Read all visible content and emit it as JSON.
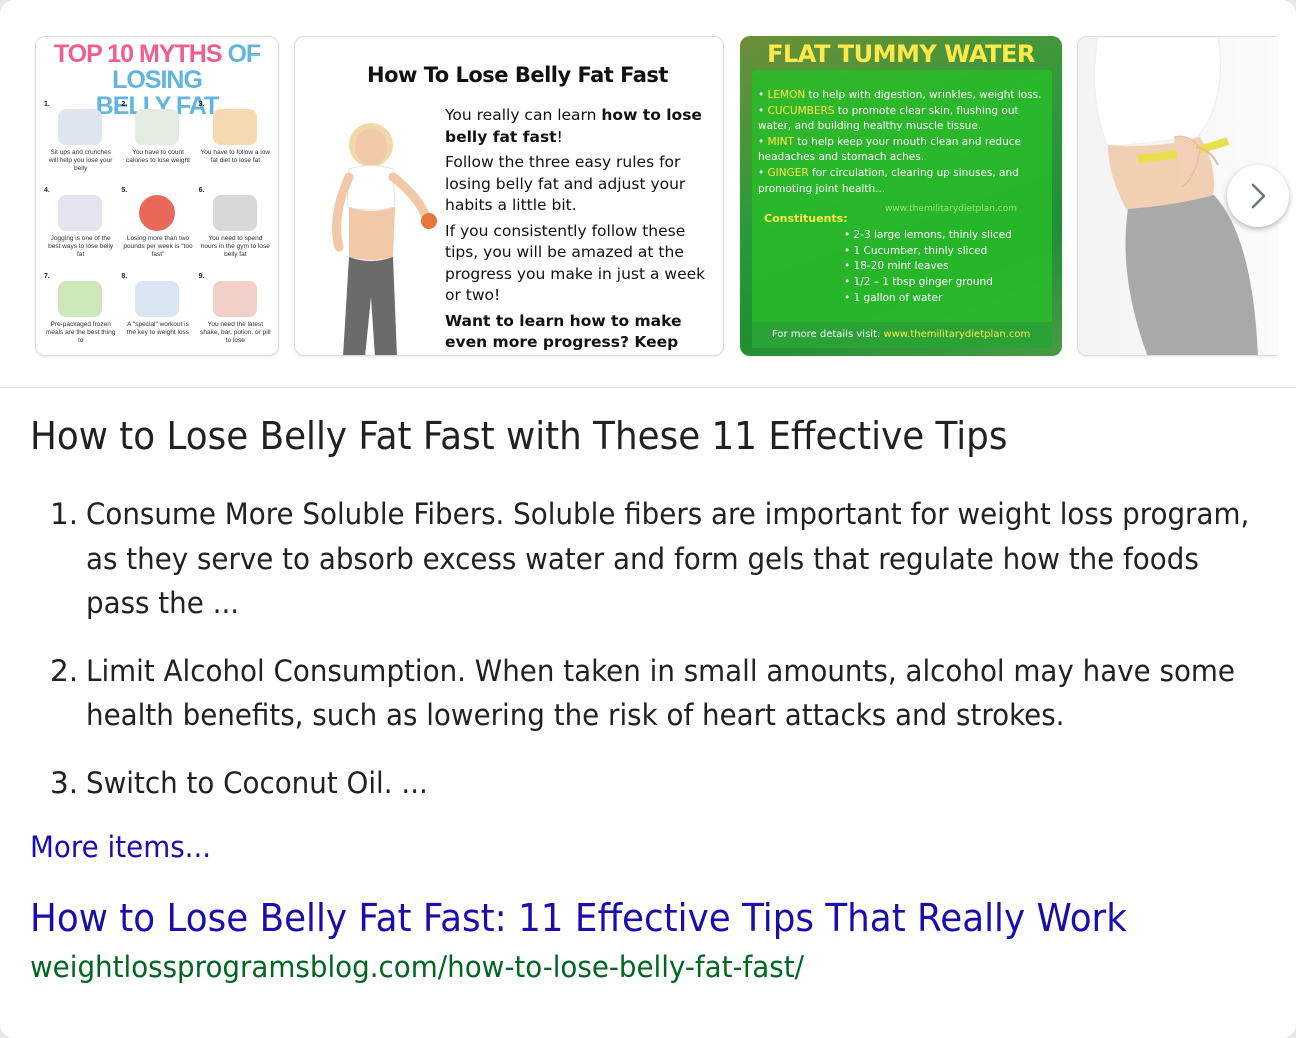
{
  "carousel": {
    "images": [
      {
        "title_line1_a": "TOP 10 ",
        "title_line1_b": "MYTHS ",
        "title_line1_c": "OF LOSING",
        "title_line2": "BELLY FAT",
        "cells": [
          {
            "num": "1.",
            "caption": "Sit ups and crunches will help you lose your belly"
          },
          {
            "num": "2.",
            "caption": "You have to count calories to lose weight"
          },
          {
            "num": "3.",
            "caption": "You have to follow a low fat diet to lose fat"
          },
          {
            "num": "4.",
            "caption": "Jogging is one of the best ways to lose belly fat"
          },
          {
            "num": "5.",
            "caption": "Losing more than two pounds per week is \"too fast\""
          },
          {
            "num": "6.",
            "caption": "You need to spend hours in the gym to lose belly fat"
          },
          {
            "num": "7.",
            "caption": "Pre-packaged frozen meals are the best thing to"
          },
          {
            "num": "8.",
            "caption": "A \"special\" workout is the key to weight loss"
          },
          {
            "num": "9.",
            "caption": "You need the latest shake, bar, potion, or pill to lose"
          }
        ]
      },
      {
        "title": "How To Lose Belly Fat Fast",
        "p1_a": "You really can learn ",
        "p1_b": "how to lose belly fat fast",
        "p1_c": "!",
        "p2": "Follow the three easy rules for losing belly fat and adjust your habits a little bit.",
        "p3": "If you consistently follow these tips, you will be amazed at the progress you make in just a week or two!",
        "p4": "Want to learn how to make even more progress?  Keep Reading!"
      },
      {
        "title": "FLAT TUMMY WATER",
        "bullets": [
          {
            "kw": "LEMON",
            "text": " to help with digestion, wrinkles, weight loss."
          },
          {
            "kw": "CUCUMBERS",
            "text": " to promote clear skin, flushing out water, and building healthy muscle tissue."
          },
          {
            "kw": "MINT",
            "text": " to help keep your mouth clean and reduce headaches and stomach aches."
          },
          {
            "kw": "GINGER",
            "text": " for circulation, clearing up sinuses, and promoting joint health..."
          }
        ],
        "watermark": "www.themilitarydietplan.com",
        "constituents_label": "Constituents:",
        "ingredients": [
          "2-3 large lemons, thinly sliced",
          "1 Cucumber, thinly sliced",
          "18-20 mint leaves",
          "1/2 – 1 tbsp ginger ground",
          "1 gallon of water"
        ],
        "footer_label": "For more details visit: ",
        "footer_link": "www.themilitarydietplan.com"
      },
      {}
    ],
    "next_icon": "chevron-right-icon"
  },
  "snippet": {
    "heading": "How to Lose Belly Fat Fast with These 11 Effective Tips",
    "steps": [
      {
        "num": "1.",
        "text": "Consume More Soluble Fibers. Soluble fibers are important for weight loss program,",
        "text2": "as they serve to absorb excess water and form gels that regulate how the foods",
        "text3": "pass the ..."
      },
      {
        "num": "2.",
        "text": "Limit Alcohol Consumption. When taken in small amounts, alcohol may have some",
        "text2": "health benefits, such as lowering the risk of heart attacks and strokes."
      },
      {
        "num": "3.",
        "text": "Switch to Coconut Oil. ..."
      }
    ],
    "more_items": "More items...",
    "result_title": "How to Lose Belly Fat Fast: 11 Effective Tips That Really Work",
    "result_url": "weightlossprogramsblog.com/how-to-lose-belly-fat-fast/"
  },
  "colors": {
    "link": "#1a0dab",
    "url": "#006621",
    "text": "#202124"
  }
}
